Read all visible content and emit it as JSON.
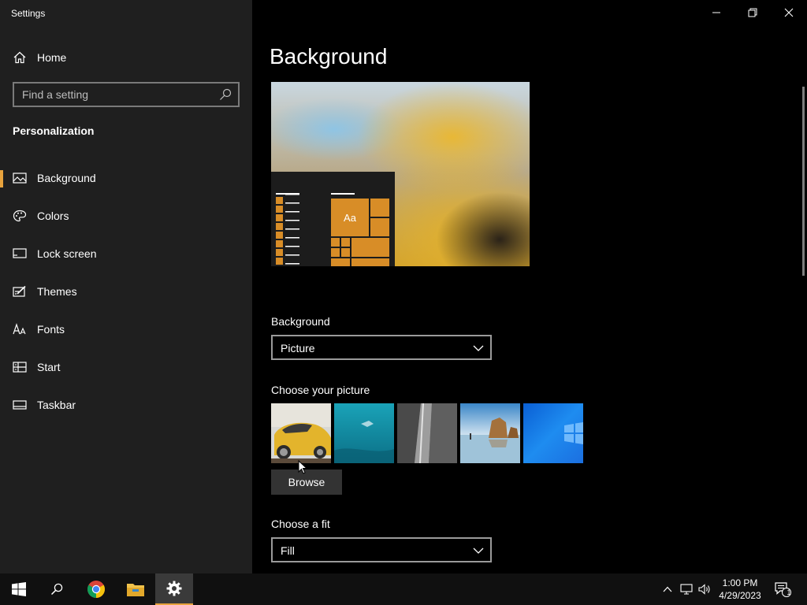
{
  "window": {
    "title": "Settings"
  },
  "sidebar": {
    "home_label": "Home",
    "search_placeholder": "Find a setting",
    "section_title": "Personalization",
    "items": [
      {
        "label": "Background",
        "icon": "picture-icon",
        "active": true
      },
      {
        "label": "Colors",
        "icon": "palette-icon",
        "active": false
      },
      {
        "label": "Lock screen",
        "icon": "lock-screen-icon",
        "active": false
      },
      {
        "label": "Themes",
        "icon": "themes-icon",
        "active": false
      },
      {
        "label": "Fonts",
        "icon": "fonts-icon",
        "active": false
      },
      {
        "label": "Start",
        "icon": "start-icon",
        "active": false
      },
      {
        "label": "Taskbar",
        "icon": "taskbar-icon",
        "active": false
      }
    ]
  },
  "main": {
    "title": "Background",
    "preview": {
      "tile_text": "Aa"
    },
    "background_label": "Background",
    "background_value": "Picture",
    "choose_picture_label": "Choose your picture",
    "pictures": [
      "yellow-car",
      "underwater-swimmer",
      "rock-cliff",
      "beach-rocks",
      "windows-logo"
    ],
    "browse_label": "Browse",
    "fit_label": "Choose a fit",
    "fit_value": "Fill"
  },
  "taskbar": {
    "time": "1:00 PM",
    "date": "4/29/2023",
    "notification_count": "1"
  },
  "colors": {
    "accent": "#e8a33d",
    "tile": "#d88d27",
    "sidebar_bg": "#1f1f1f",
    "main_bg": "#000000"
  }
}
